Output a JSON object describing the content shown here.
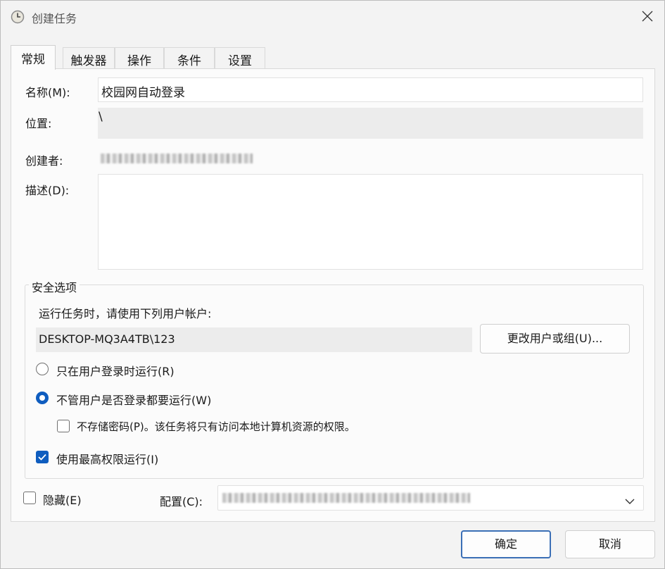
{
  "window": {
    "title": "创建任务",
    "icon": "clock-icon",
    "close_icon": "close-icon"
  },
  "tabs": [
    {
      "label": "常规",
      "active": true
    },
    {
      "label": "触发器",
      "active": false
    },
    {
      "label": "操作",
      "active": false
    },
    {
      "label": "条件",
      "active": false
    },
    {
      "label": "设置",
      "active": false
    }
  ],
  "general": {
    "name_label": "名称(M):",
    "name_value": "校园网自动登录",
    "location_label": "位置:",
    "location_value": "\\",
    "author_label": "创建者:",
    "description_label": "描述(D):",
    "description_value": ""
  },
  "security": {
    "title": "安全选项",
    "run_as_prompt": "运行任务时，请使用下列用户帐户:",
    "account": "DESKTOP-MQ3A4TB\\123",
    "change_user_button": "更改用户或组(U)...",
    "radio_logged_on_only": "只在用户登录时运行(R)",
    "radio_logged_on_only_selected": false,
    "radio_whether_logged_on": "不管用户是否登录都要运行(W)",
    "radio_whether_logged_on_selected": true,
    "checkbox_no_store_password": "不存储密码(P)。该任务将只有访问本地计算机资源的权限。",
    "checkbox_no_store_password_checked": false,
    "checkbox_highest_privileges": "使用最高权限运行(I)",
    "checkbox_highest_privileges_checked": true
  },
  "bottom": {
    "hidden_label": "隐藏(E)",
    "hidden_checked": false,
    "configure_label": "配置(C):",
    "configure_dropdown_icon": "chevron-down-icon"
  },
  "footer": {
    "ok_button": "确定",
    "cancel_button": "取消"
  },
  "colors": {
    "accent": "#0f5dbf",
    "background": "#f3f3f3",
    "panel": "#fbfbfb"
  }
}
